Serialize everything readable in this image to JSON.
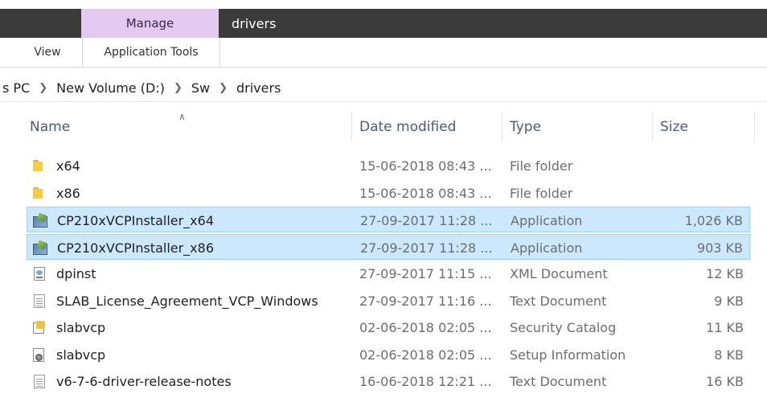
{
  "titlebar": {
    "context_tab": "Manage",
    "title": "drivers"
  },
  "ribbon": {
    "tabs": [
      "View",
      "Application Tools"
    ]
  },
  "breadcrumb": [
    "s PC",
    "New Volume (D:)",
    "Sw",
    "drivers"
  ],
  "columns": {
    "name": "Name",
    "date": "Date modified",
    "type": "Type",
    "size": "Size"
  },
  "files": [
    {
      "icon": "folder-icon",
      "name": "x64",
      "date": "15-06-2018 08:43 ...",
      "type": "File folder",
      "size": "",
      "selected": false
    },
    {
      "icon": "folder-icon",
      "name": "x86",
      "date": "15-06-2018 08:43 ...",
      "type": "File folder",
      "size": "",
      "selected": false
    },
    {
      "icon": "application-icon",
      "name": "CP210xVCPInstaller_x64",
      "date": "27-09-2017 11:28 ...",
      "type": "Application",
      "size": "1,026 KB",
      "selected": true
    },
    {
      "icon": "application-icon",
      "name": "CP210xVCPInstaller_x86",
      "date": "27-09-2017 11:28 ...",
      "type": "Application",
      "size": "903 KB",
      "selected": true
    },
    {
      "icon": "xml-document-icon",
      "name": "dpinst",
      "date": "27-09-2017 11:15 ...",
      "type": "XML Document",
      "size": "12 KB",
      "selected": false
    },
    {
      "icon": "text-document-icon",
      "name": "SLAB_License_Agreement_VCP_Windows",
      "date": "27-09-2017 11:16 ...",
      "type": "Text Document",
      "size": "9 KB",
      "selected": false
    },
    {
      "icon": "security-catalog-icon",
      "name": "slabvcp",
      "date": "02-06-2018 02:05 ...",
      "type": "Security Catalog",
      "size": "11 KB",
      "selected": false
    },
    {
      "icon": "setup-information-icon",
      "name": "slabvcp",
      "date": "02-06-2018 02:05 ...",
      "type": "Setup Information",
      "size": "8 KB",
      "selected": false
    },
    {
      "icon": "text-document-icon",
      "name": "v6-7-6-driver-release-notes",
      "date": "16-06-2018 12:21 ...",
      "type": "Text Document",
      "size": "16 KB",
      "selected": false
    }
  ],
  "colors": {
    "titlebar_bg": "#3b3b3b",
    "manage_tab_bg": "#e3c8f0",
    "selection_bg": "#cce8ff",
    "selection_border": "#99d1ff",
    "header_text": "#4a5b74"
  }
}
